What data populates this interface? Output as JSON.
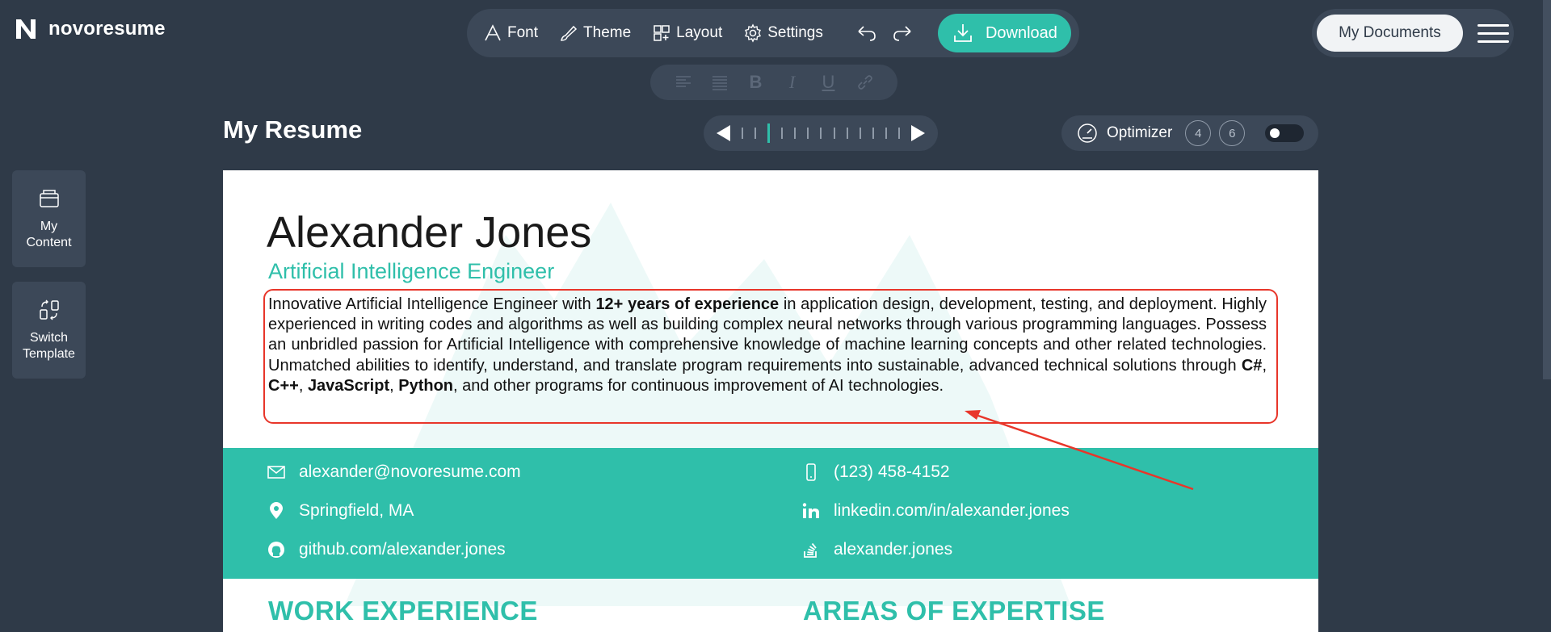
{
  "app": {
    "name": "novoresume"
  },
  "toolbar": {
    "font": "Font",
    "theme": "Theme",
    "layout": "Layout",
    "settings": "Settings",
    "download": "Download"
  },
  "header_right": {
    "my_documents": "My Documents"
  },
  "format": {
    "bold": "B",
    "italic": "I",
    "underline": "U"
  },
  "page": {
    "title": "My Resume"
  },
  "optimizer": {
    "label": "Optimizer",
    "badge1": "4",
    "badge2": "6",
    "enabled": false
  },
  "sidebar": {
    "my_content_line1": "My",
    "my_content_line2": "Content",
    "switch_line1": "Switch",
    "switch_line2": "Template"
  },
  "resume": {
    "name": "Alexander Jones",
    "title": "Artificial Intelligence Engineer",
    "summary": {
      "p1": "Innovative Artificial Intelligence Engineer with ",
      "b1": "12+ years of experience",
      "p2": " in application design, development, testing, and deployment. Highly experienced in writing codes and algorithms as well as building complex neural networks through various programming languages. Possess an unbridled passion for Artificial Intelligence with comprehensive knowledge of machine learning concepts and other related technologies. Unmatched abilities to identify, understand, and translate program requirements into sustainable, advanced technical solutions through ",
      "b2": "C#",
      "p3": ", ",
      "b3": "C++",
      "p4": ", ",
      "b4": "JavaScript",
      "p5": ", ",
      "b5": "Python",
      "p6": ", and other programs for continuous improvement of AI technologies."
    },
    "contact": {
      "email": "alexander@novoresume.com",
      "phone": "(123) 458-4152",
      "location": "Springfield, MA",
      "linkedin": "linkedin.com/in/alexander.jones",
      "github": "github.com/alexander.jones",
      "stackoverflow": "alexander.jones"
    },
    "sections": {
      "work": "WORK EXPERIENCE",
      "expertise": "AREAS OF EXPERTISE"
    }
  },
  "colors": {
    "accent": "#2fbfaa",
    "background": "#2f3a48",
    "highlight": "#e8362a"
  }
}
